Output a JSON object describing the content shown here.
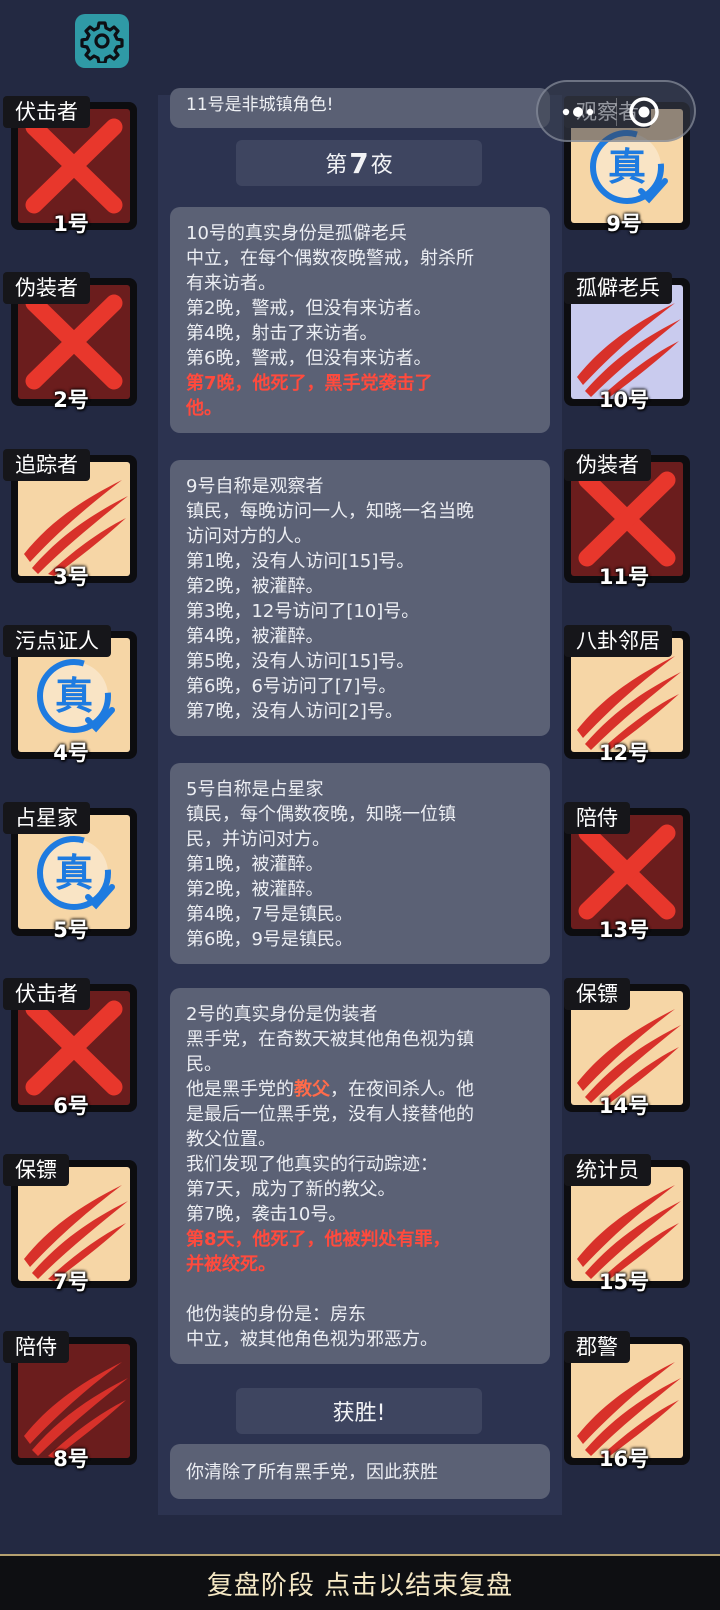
{
  "log": {
    "top_cut_text": "11号是非城镇角色!",
    "night_header": {
      "prefix": "第",
      "number": "7",
      "suffix": "夜"
    },
    "msg1": {
      "lines": [
        "10号的真实身份是孤僻老兵",
        "中立，在每个偶数夜晚警戒，射杀所",
        "有来访者。",
        "第2晚，警戒，但没有来访者。",
        "第4晚，射击了来访者。",
        "第6晚，警戒，但没有来访者。"
      ],
      "red_lines": [
        "第7晚，他死了，黑手党袭击了",
        "他。"
      ]
    },
    "msg2": {
      "lines": [
        "9号自称是观察者",
        "镇民，每晚访问一人，知晓一名当晚",
        "访问对方的人。",
        "第1晚，没有人访问[15]号。",
        "第2晚，被灌醉。",
        "第3晚，12号访问了[10]号。",
        "第4晚，被灌醉。",
        "第5晚，没有人访问[15]号。",
        "第6晚，6号访问了[7]号。",
        "第7晚，没有人访问[2]号。"
      ]
    },
    "msg3": {
      "lines": [
        "5号自称是占星家",
        "镇民，每个偶数夜晚，知晓一位镇",
        "民，并访问对方。",
        "第1晚，被灌醉。",
        "第2晚，被灌醉。",
        "第4晚，7号是镇民。",
        "第6晚，9号是镇民。"
      ]
    },
    "msg4": {
      "lines_a": [
        "2号的真实身份是伪装者",
        "黑手党，在奇数天被其他角色视为镇",
        "民。"
      ],
      "godfather_pre": "他是黑手党的",
      "godfather_word": "教父",
      "godfather_post": "，在夜间杀人。他",
      "lines_b": [
        "是最后一位黑手党，没有人接替他的",
        "教父位置。",
        "我们发现了他真实的行动踪迹：",
        "第7天，成为了新的教父。",
        "第7晚，袭击10号。"
      ],
      "red_lines": [
        "第8天，他死了，他被判处有罪，",
        "并被绞死。"
      ],
      "lines_c": [
        "他伪装的身份是：房东",
        "中立，被其他角色视为邪恶方。"
      ]
    },
    "victory_header": "获胜!",
    "victory_text": "你清除了所有黑手党，因此获胜"
  },
  "players_left": [
    {
      "role": "伏击者",
      "num": "1号",
      "state": "dead-x"
    },
    {
      "role": "伪装者",
      "num": "2号",
      "state": "dead-x"
    },
    {
      "role": "追踪者",
      "num": "3号",
      "state": "claw"
    },
    {
      "role": "污点证人",
      "num": "4号",
      "state": "verified"
    },
    {
      "role": "占星家",
      "num": "5号",
      "state": "verified"
    },
    {
      "role": "伏击者",
      "num": "6号",
      "state": "dead-x"
    },
    {
      "role": "保镖",
      "num": "7号",
      "state": "claw"
    },
    {
      "role": "陪侍",
      "num": "8号",
      "state": "claw-dead"
    }
  ],
  "players_right": [
    {
      "role": "观察者",
      "num": "9号",
      "state": "verified"
    },
    {
      "role": "孤僻老兵",
      "num": "10号",
      "state": "claw-lav"
    },
    {
      "role": "伪装者",
      "num": "11号",
      "state": "dead-x"
    },
    {
      "role": "八卦邻居",
      "num": "12号",
      "state": "claw"
    },
    {
      "role": "陪侍",
      "num": "13号",
      "state": "dead-x"
    },
    {
      "role": "保镖",
      "num": "14号",
      "state": "claw"
    },
    {
      "role": "统计员",
      "num": "15号",
      "state": "claw"
    },
    {
      "role": "郡警",
      "num": "16号",
      "state": "claw"
    }
  ],
  "verified_badge": "真",
  "bottom_bar": "复盘阶段 点击以结束复盘",
  "icons": {
    "settings": "gear-icon",
    "capsule_menu": "more-dots-icon",
    "capsule_close": "close-circle-icon"
  },
  "colors": {
    "background": "#232942",
    "card_dead": "#6b1d1d",
    "card_alive": "#f6d6a6",
    "death_red": "#e8372c",
    "verified_blue": "#1e7be0",
    "bar_text": "#f4e7c4"
  }
}
